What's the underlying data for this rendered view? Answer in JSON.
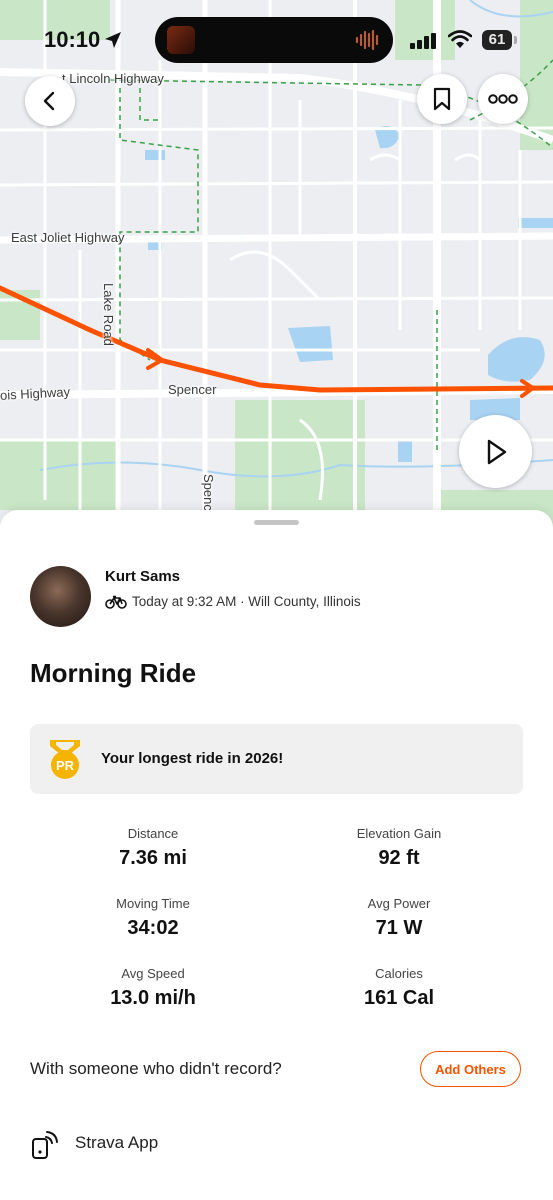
{
  "status_bar": {
    "time": "10:10",
    "battery": "61"
  },
  "map": {
    "labels": {
      "lincoln": "t Lincoln Highway",
      "joliet": "East Joliet Highway",
      "lake_road": "Lake Road",
      "illinois": "ois Highway",
      "spencer": "Spencer",
      "spencer_road": "Spenc"
    },
    "route_color": "#fc5200"
  },
  "activity": {
    "athlete_name": "Kurt Sams",
    "meta": "Today at 9:32 AM · Will County, Illinois",
    "title": "Morning Ride",
    "achievement": {
      "badge": "PR",
      "text": "Your longest ride in 2026!"
    },
    "stats": [
      {
        "label": "Distance",
        "value": "7.36 mi"
      },
      {
        "label": "Elevation Gain",
        "value": "92 ft"
      },
      {
        "label": "Moving Time",
        "value": "34:02"
      },
      {
        "label": "Avg Power",
        "value": "71 W"
      },
      {
        "label": "Avg Speed",
        "value": "13.0 mi/h"
      },
      {
        "label": "Calories",
        "value": "161 Cal"
      }
    ],
    "with_others_text": "With someone who didn't record?",
    "add_others_label": "Add Others",
    "device": "Strava App"
  },
  "colors": {
    "accent": "#fc5200",
    "badge": "#f5b400",
    "route": "#fc5200"
  },
  "icons": {
    "back": "chevron-left-icon",
    "bookmark": "bookmark-icon",
    "more": "more-icon",
    "play": "play-icon",
    "ride": "bicycle-icon",
    "device": "device-icon"
  }
}
